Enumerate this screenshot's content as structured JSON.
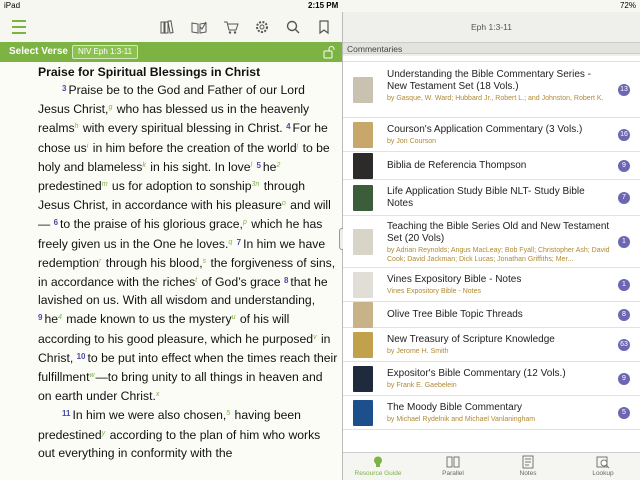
{
  "status": {
    "device": "iPad",
    "time": "2:15 PM",
    "battery": "72%"
  },
  "reader": {
    "select_verse": "Select Verse",
    "reference": "NIV Eph 1:3-11",
    "heading": "Praise for Spiritual Blessings in Christ",
    "passage": [
      {
        "t": "v",
        "v": "3"
      },
      {
        "t": "x",
        "v": "Praise be to the God and Father of our Lord Jesus Christ,"
      },
      {
        "t": "f",
        "v": "g"
      },
      {
        "t": "x",
        "v": " who has blessed us in the heavenly realms"
      },
      {
        "t": "f",
        "v": "h"
      },
      {
        "t": "x",
        "v": " with every spiritual blessing in Christ. "
      },
      {
        "t": "v",
        "v": "4"
      },
      {
        "t": "x",
        "v": "For he chose us"
      },
      {
        "t": "f",
        "v": "i"
      },
      {
        "t": "x",
        "v": " in him before the creation of the world"
      },
      {
        "t": "f",
        "v": "j"
      },
      {
        "t": "x",
        "v": " to be holy and blameless"
      },
      {
        "t": "f",
        "v": "k"
      },
      {
        "t": "x",
        "v": " in his sight. In love"
      },
      {
        "t": "f",
        "v": "l"
      },
      {
        "t": "x",
        "v": " "
      },
      {
        "t": "v",
        "v": "5"
      },
      {
        "t": "x",
        "v": "he"
      },
      {
        "t": "f",
        "v": "2"
      },
      {
        "t": "x",
        "v": " predestined"
      },
      {
        "t": "f",
        "v": "m"
      },
      {
        "t": "x",
        "v": " us for adoption to sonship"
      },
      {
        "t": "f",
        "v": "3n"
      },
      {
        "t": "x",
        "v": " through Jesus Christ, in accordance with his pleasure"
      },
      {
        "t": "f",
        "v": "o"
      },
      {
        "t": "x",
        "v": " and will— "
      },
      {
        "t": "v",
        "v": "6"
      },
      {
        "t": "x",
        "v": "to the praise of his glorious grace,"
      },
      {
        "t": "f",
        "v": "p"
      },
      {
        "t": "x",
        "v": " which he has freely given us in the One he loves."
      },
      {
        "t": "f",
        "v": "q"
      },
      {
        "t": "x",
        "v": " "
      },
      {
        "t": "v",
        "v": "7"
      },
      {
        "t": "x",
        "v": "In him we have redemption"
      },
      {
        "t": "f",
        "v": "r"
      },
      {
        "t": "x",
        "v": " through his blood,"
      },
      {
        "t": "f",
        "v": "s"
      },
      {
        "t": "x",
        "v": " the forgiveness of sins, in accordance with the riches"
      },
      {
        "t": "f",
        "v": "t"
      },
      {
        "t": "x",
        "v": " of God’s grace "
      },
      {
        "t": "v",
        "v": "8"
      },
      {
        "t": "x",
        "v": "that he lavished on us. With all wisdom and understanding, "
      },
      {
        "t": "v",
        "v": "9"
      },
      {
        "t": "x",
        "v": "he"
      },
      {
        "t": "f",
        "v": "4"
      },
      {
        "t": "x",
        "v": " made known to us the mystery"
      },
      {
        "t": "f",
        "v": "u"
      },
      {
        "t": "x",
        "v": " of his will according to his good pleasure, which he purposed"
      },
      {
        "t": "f",
        "v": "v"
      },
      {
        "t": "x",
        "v": " in Christ, "
      },
      {
        "t": "v",
        "v": "10"
      },
      {
        "t": "x",
        "v": "to be put into effect when the times reach their fulfillment"
      },
      {
        "t": "f",
        "v": "w"
      },
      {
        "t": "x",
        "v": "—to bring unity to all things in heaven and on earth under Christ."
      },
      {
        "t": "f",
        "v": "x"
      }
    ],
    "passage2": [
      {
        "t": "v",
        "v": "11"
      },
      {
        "t": "x",
        "v": "In him we were also chosen,"
      },
      {
        "t": "f",
        "v": "5"
      },
      {
        "t": "x",
        "v": " having been predestined"
      },
      {
        "t": "f",
        "v": "y"
      },
      {
        "t": "x",
        "v": " according to the plan of him who works out everything in conformity with the"
      }
    ]
  },
  "panel": {
    "title": "Eph 1:3-11",
    "section": "Commentaries",
    "items": [
      {
        "title": "Understanding the Bible Commentary Series - New Testament Set (18 Vols.)",
        "sub": "by Gasque, W. Ward; Hubbard Jr., Robert L.; and Johnston, Robert K.",
        "badge": "13",
        "color": "#c9c2b0",
        "h": 56
      },
      {
        "title": "Courson's Application Commentary (3 Vols.)",
        "sub": "by Jon Courson",
        "badge": "16",
        "color": "#c8a86a",
        "h": 34
      },
      {
        "title": "Biblia de Referencia Thompson",
        "sub": "",
        "badge": "9",
        "color": "#2d2a2a",
        "h": 28
      },
      {
        "title": "Life Application Study Bible NLT-  Study Bible Notes",
        "sub": "",
        "badge": "7",
        "color": "#3b5d3a",
        "h": 36
      },
      {
        "title": "Teaching the Bible Series Old and New Testament Set (20 Vols)",
        "sub": "by Adrian Reynolds; Angus MacLeay; Bob Fyall; Christopher Ash; David Cook; David Jackman; Dick Lucas; Jonathan Griffiths; Mer...",
        "badge": "1",
        "color": "#d8d4c8",
        "h": 52
      },
      {
        "title": "Vines Expository Bible - Notes",
        "sub": "Vines Expository Bible - Notes",
        "badge": "1",
        "color": "#e0ded6",
        "h": 34
      },
      {
        "title": "Olive Tree Bible Topic Threads",
        "sub": "",
        "badge": "8",
        "color": "#c7b387",
        "h": 26
      },
      {
        "title": "New Treasury of Scripture Knowledge",
        "sub": "by Jerome H. Smith",
        "badge": "63",
        "color": "#c2a14d",
        "h": 34
      },
      {
        "title": "Expositor's Bible Commentary (12 Vols.)",
        "sub": "by Frank E. Gaebelein",
        "badge": "9",
        "color": "#1f2a3c",
        "h": 34
      },
      {
        "title": "The Moody Bible Commentary",
        "sub": "by Michael Rydelnik and Michael Vanlaningham",
        "badge": "5",
        "color": "#1c4f8c",
        "h": 34
      }
    ],
    "tabs": [
      "Resource Guide",
      "Parallel",
      "Notes",
      "Lookup"
    ]
  },
  "colors": {
    "accent": "#7cb342",
    "badge": "#6d67b3",
    "verse": "#4a4aa5"
  }
}
